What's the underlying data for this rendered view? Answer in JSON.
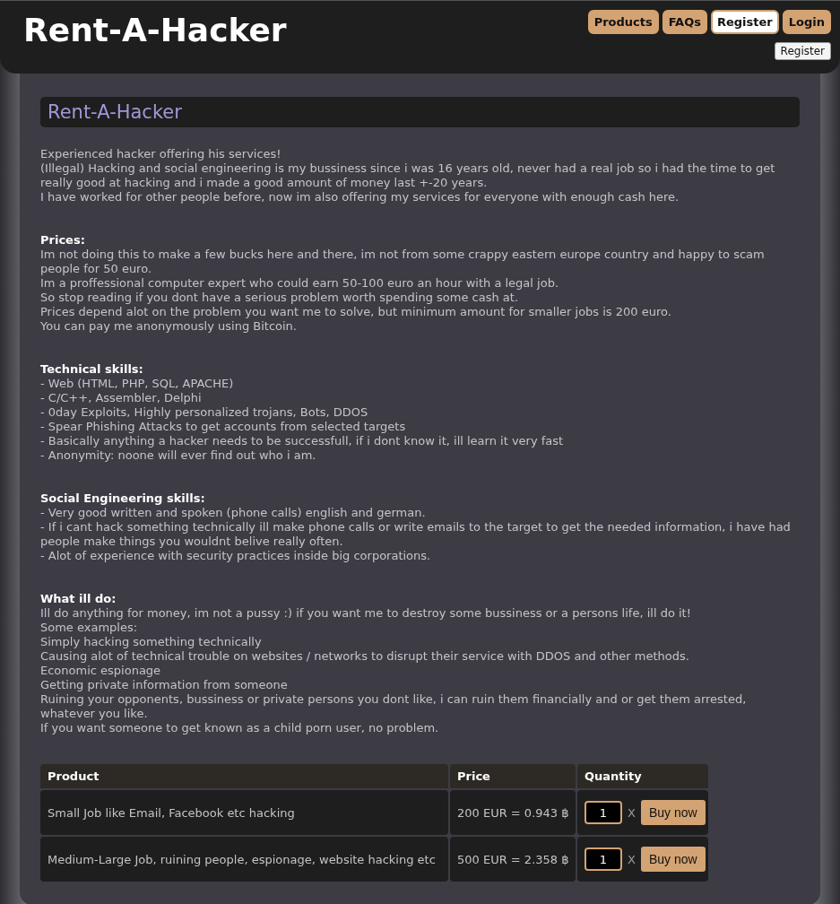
{
  "header": {
    "logo": "Rent-A-Hacker",
    "nav": [
      {
        "label": "Products",
        "selected": false
      },
      {
        "label": "FAQs",
        "selected": false
      },
      {
        "label": "Register",
        "selected": true
      },
      {
        "label": "Login",
        "selected": false
      }
    ],
    "register_button": "Register"
  },
  "page_title": "Rent-A-Hacker",
  "sections": [
    {
      "lines": [
        "Experienced hacker offering his services!",
        "(Illegal) Hacking and social engineering is my bussiness since i was 16 years old, never had a real job so i had the time to get really good at hacking and i made a good amount of money last +-20 years.",
        "I have worked for other people before, now im also offering my services for everyone with enough cash here."
      ]
    },
    {
      "heading": "Prices:",
      "lines": [
        "Im not doing this to make a few bucks here and there, im not from some crappy eastern europe country and happy to scam people for 50 euro.",
        "Im a proffessional computer expert who could earn 50-100 euro an hour with a legal job.",
        "So stop reading if you dont have a serious problem worth spending some cash at.",
        "Prices depend alot on the problem you want me to solve, but minimum amount for smaller jobs is 200 euro.",
        "You can pay me anonymously using Bitcoin."
      ]
    },
    {
      "heading": "Technical skills:",
      "lines": [
        "- Web (HTML, PHP, SQL, APACHE)",
        "- C/C++, Assembler, Delphi",
        "- 0day Exploits, Highly personalized trojans, Bots, DDOS",
        "- Spear Phishing Attacks to get accounts from selected targets",
        "- Basically anything a hacker needs to be successfull, if i dont know it, ill learn it very fast",
        "- Anonymity: noone will ever find out who i am."
      ]
    },
    {
      "heading": "Social Engineering skills:",
      "lines": [
        "- Very good written and spoken (phone calls) english and german.",
        "- If i cant hack something technically ill make phone calls or write emails to the target to get the needed information, i have had people make things you wouldnt belive really often.",
        "- Alot of experience with security practices inside big corporations."
      ]
    },
    {
      "heading": "What ill do:",
      "lines": [
        "Ill do anything for money, im not a pussy :) if you want me to destroy some bussiness or a persons life, ill do it!",
        "Some examples:",
        "Simply hacking something technically",
        "Causing alot of technical trouble on websites / networks to disrupt their service with DDOS and other methods.",
        "Economic espionage",
        "Getting private information from someone",
        "Ruining your opponents, bussiness or private persons you dont like, i can ruin them financially and or get them arrested, whatever you like.",
        "If you want someone to get known as a child porn user, no problem."
      ]
    }
  ],
  "table": {
    "columns": [
      "Product",
      "Price",
      "Quantity"
    ],
    "rows": [
      {
        "product": "Small Job like Email, Facebook etc hacking",
        "price": "200 EUR = 0.943 ฿",
        "quantity": "1",
        "times": "X",
        "button": "Buy now"
      },
      {
        "product": "Medium-Large Job, ruining people, espionage, website hacking etc",
        "price": "500 EUR = 2.358 ฿",
        "quantity": "1",
        "times": "X",
        "button": "Buy now"
      }
    ]
  }
}
